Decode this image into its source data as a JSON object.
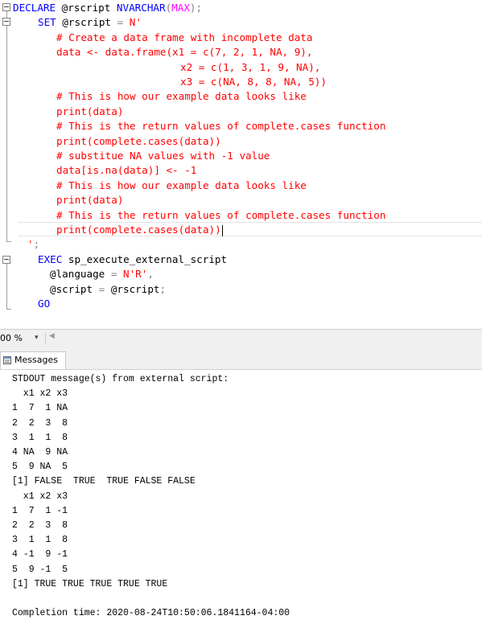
{
  "editor": {
    "lines": [
      {
        "segments": [
          {
            "t": "DECLARE",
            "c": "kw"
          },
          {
            "t": " @rscript ",
            "c": "var"
          },
          {
            "t": "NVARCHAR",
            "c": "kw"
          },
          {
            "t": "(",
            "c": "gray"
          },
          {
            "t": "MAX",
            "c": "fn"
          },
          {
            "t": ");",
            "c": "gray"
          }
        ]
      },
      {
        "segments": [
          {
            "t": "SET",
            "c": "kw"
          },
          {
            "t": " @rscript ",
            "c": "var"
          },
          {
            "t": "=",
            "c": "gray"
          },
          {
            "t": " ",
            "c": "var"
          },
          {
            "t": "N'",
            "c": "str"
          }
        ]
      },
      {
        "segments": [
          {
            "t": "# Create a data frame with incomplete data",
            "c": "str"
          }
        ]
      },
      {
        "segments": [
          {
            "t": "data <- data.frame(x1 = c(7, 2, 1, NA, 9),",
            "c": "str"
          }
        ]
      },
      {
        "segments": [
          {
            "t": "x2 = c(1, 3, 1, 9, NA),",
            "c": "str"
          }
        ]
      },
      {
        "segments": [
          {
            "t": "x3 = c(NA, 8, 8, NA, 5))",
            "c": "str"
          }
        ]
      },
      {
        "segments": [
          {
            "t": "# This is how our example data looks like",
            "c": "str"
          }
        ]
      },
      {
        "segments": [
          {
            "t": "print(data)",
            "c": "str"
          }
        ]
      },
      {
        "segments": [
          {
            "t": "# This is the return values of complete.cases function",
            "c": "str"
          }
        ]
      },
      {
        "segments": [
          {
            "t": "print(complete.cases(data))",
            "c": "str"
          }
        ]
      },
      {
        "segments": [
          {
            "t": "# substitue NA values with -1 value",
            "c": "str"
          }
        ]
      },
      {
        "segments": [
          {
            "t": "data[is.na(data)] <- -1",
            "c": "str"
          }
        ]
      },
      {
        "segments": [
          {
            "t": "# This is how our example data looks like",
            "c": "str"
          }
        ]
      },
      {
        "segments": [
          {
            "t": "print(data)",
            "c": "str"
          }
        ]
      },
      {
        "segments": [
          {
            "t": "# This is the return values of complete.cases function",
            "c": "str"
          }
        ]
      },
      {
        "segments": [
          {
            "t": "print(complete.cases(data))",
            "c": "str"
          }
        ]
      },
      {
        "segments": [
          {
            "t": "'",
            "c": "str"
          },
          {
            "t": ";",
            "c": "gray"
          }
        ]
      },
      {
        "segments": [
          {
            "t": "EXEC",
            "c": "kw"
          },
          {
            "t": " sp_execute_external_script",
            "c": "var"
          }
        ]
      },
      {
        "segments": [
          {
            "t": "@language ",
            "c": "var"
          },
          {
            "t": "=",
            "c": "gray"
          },
          {
            "t": " ",
            "c": "var"
          },
          {
            "t": "N'R'",
            "c": "str"
          },
          {
            "t": ",",
            "c": "gray"
          }
        ]
      },
      {
        "segments": [
          {
            "t": "@script ",
            "c": "var"
          },
          {
            "t": "=",
            "c": "gray"
          },
          {
            "t": " @rscript",
            "c": "var"
          },
          {
            "t": ";",
            "c": "gray"
          }
        ]
      },
      {
        "segments": [
          {
            "t": "GO",
            "c": "kw"
          }
        ]
      }
    ]
  },
  "statusbar": {
    "zoom": "00 %",
    "zoom_arrow": "▾",
    "scroll_left": "◀"
  },
  "results": {
    "tab_label": "Messages",
    "lines": [
      "STDOUT message(s) from external script:",
      "  x1 x2 x3",
      "1  7  1 NA",
      "2  2  3  8",
      "3  1  1  8",
      "4 NA  9 NA",
      "5  9 NA  5",
      "[1] FALSE  TRUE  TRUE FALSE FALSE",
      "  x1 x2 x3",
      "1  7  1 -1",
      "2  2  3  8",
      "3  1  1  8",
      "4 -1  9 -1",
      "5  9 -1  5",
      "[1] TRUE TRUE TRUE TRUE TRUE",
      "",
      "Completion time: 2020-08-24T10:50:06.1841164-04:00"
    ]
  }
}
